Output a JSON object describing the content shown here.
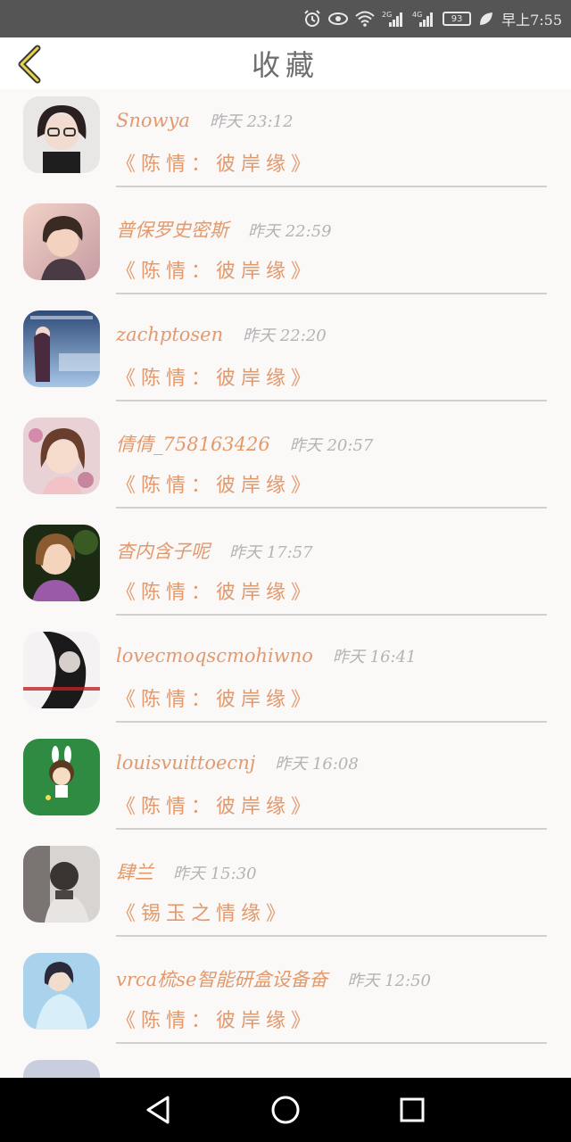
{
  "status_bar": {
    "network_2g": "2G",
    "network_4g": "4G",
    "battery": "93",
    "time_text": "早上7:55",
    "icons": [
      "alarm-icon",
      "eye-icon",
      "wifi-icon",
      "signal-icon",
      "battery-icon",
      "leaf-icon"
    ]
  },
  "header": {
    "back_icon": "chevron-left-icon",
    "title": "收藏",
    "accent": "#e29a6d"
  },
  "items": [
    {
      "user": "Snowya",
      "time": "昨天 23:12",
      "title": "《陈情：彼岸缘》",
      "avatar": "avatar-1"
    },
    {
      "user": "普保罗史密斯",
      "time": "昨天 22:59",
      "title": "《陈情：彼岸缘》",
      "avatar": "avatar-2"
    },
    {
      "user": "zachptosen",
      "time": "昨天 22:20",
      "title": "《陈情：彼岸缘》",
      "avatar": "avatar-3"
    },
    {
      "user": "倩倩_758163426",
      "time": "昨天 20:57",
      "title": "《陈情：彼岸缘》",
      "avatar": "avatar-4"
    },
    {
      "user": "杳内含子呢",
      "time": "昨天 17:57",
      "title": "《陈情：彼岸缘》",
      "avatar": "avatar-5"
    },
    {
      "user": "lovecmoqscmohiwno",
      "time": "昨天 16:41",
      "title": "《陈情：彼岸缘》",
      "avatar": "avatar-6"
    },
    {
      "user": "louisvuittoecnj",
      "time": "昨天 16:08",
      "title": "《陈情：彼岸缘》",
      "avatar": "avatar-7"
    },
    {
      "user": "肆兰",
      "time": "昨天 15:30",
      "title": "《锡玉之情缘》",
      "avatar": "avatar-8"
    },
    {
      "user": "vrca梳se智能研盒设备奋",
      "time": "昨天 12:50",
      "title": "《陈情：彼岸缘》",
      "avatar": "avatar-9"
    }
  ],
  "nav": {
    "back": "triangle-back-icon",
    "home": "circle-home-icon",
    "recent": "square-recent-icon"
  }
}
